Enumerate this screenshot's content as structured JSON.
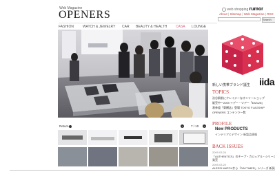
{
  "header": {
    "magazine_label": "Web Magazine",
    "title": "OPENERS",
    "web_shopping_label": "web shopping",
    "web_shopping_brand": "rumor",
    "top_links": [
      "About",
      "Sitemap",
      "Web Magazine",
      "RSS"
    ],
    "search_placeholder": "",
    "search_button": "Search"
  },
  "nav": {
    "items": [
      {
        "label": "FASHION",
        "active": false
      },
      {
        "label": "WATCH & JEWELRY",
        "active": false
      },
      {
        "label": "CAR",
        "active": false
      },
      {
        "label": "BEAUTY & HEALTH",
        "active": false
      },
      {
        "label": "CASA",
        "active": true
      },
      {
        "label": "LOUNGE",
        "active": false
      }
    ]
  },
  "feature": {
    "caption": "新しい携帯ブランド誕生",
    "brand": "iida"
  },
  "topics": {
    "heading": "TOPICS",
    "items": [
      "渋谷駅前にクレイジーなオンリーショップ",
      "販売中～2009 イデー・ツアー「EASUN」",
      "表参道「東横店」登場 TOKYO FLAGSHIP",
      "OPENERS コンテンツ一覧"
    ]
  },
  "profile": {
    "heading": "PROFILE",
    "title": "New PRODUCTS",
    "subtitle": "インテリアとデザイン 新製品情報"
  },
  "back_issues": {
    "heading": "BACK ISSUES",
    "items": [
      {
        "date": "2009.03.24",
        "text": "「AUTHENTICS」のチープ・カジュアル・シリーズ「PL",
        "extra": "発売"
      },
      {
        "date": "2009.03.20",
        "text": "ALESSI WATCHから「DAYTIMER」シリーズ 新発売"
      }
    ]
  },
  "gallery": {
    "label": "Return",
    "counter": "7 / 10"
  },
  "colors": {
    "accent": "#c43d3a",
    "nav_active": "#e06080",
    "text": "#333333"
  }
}
